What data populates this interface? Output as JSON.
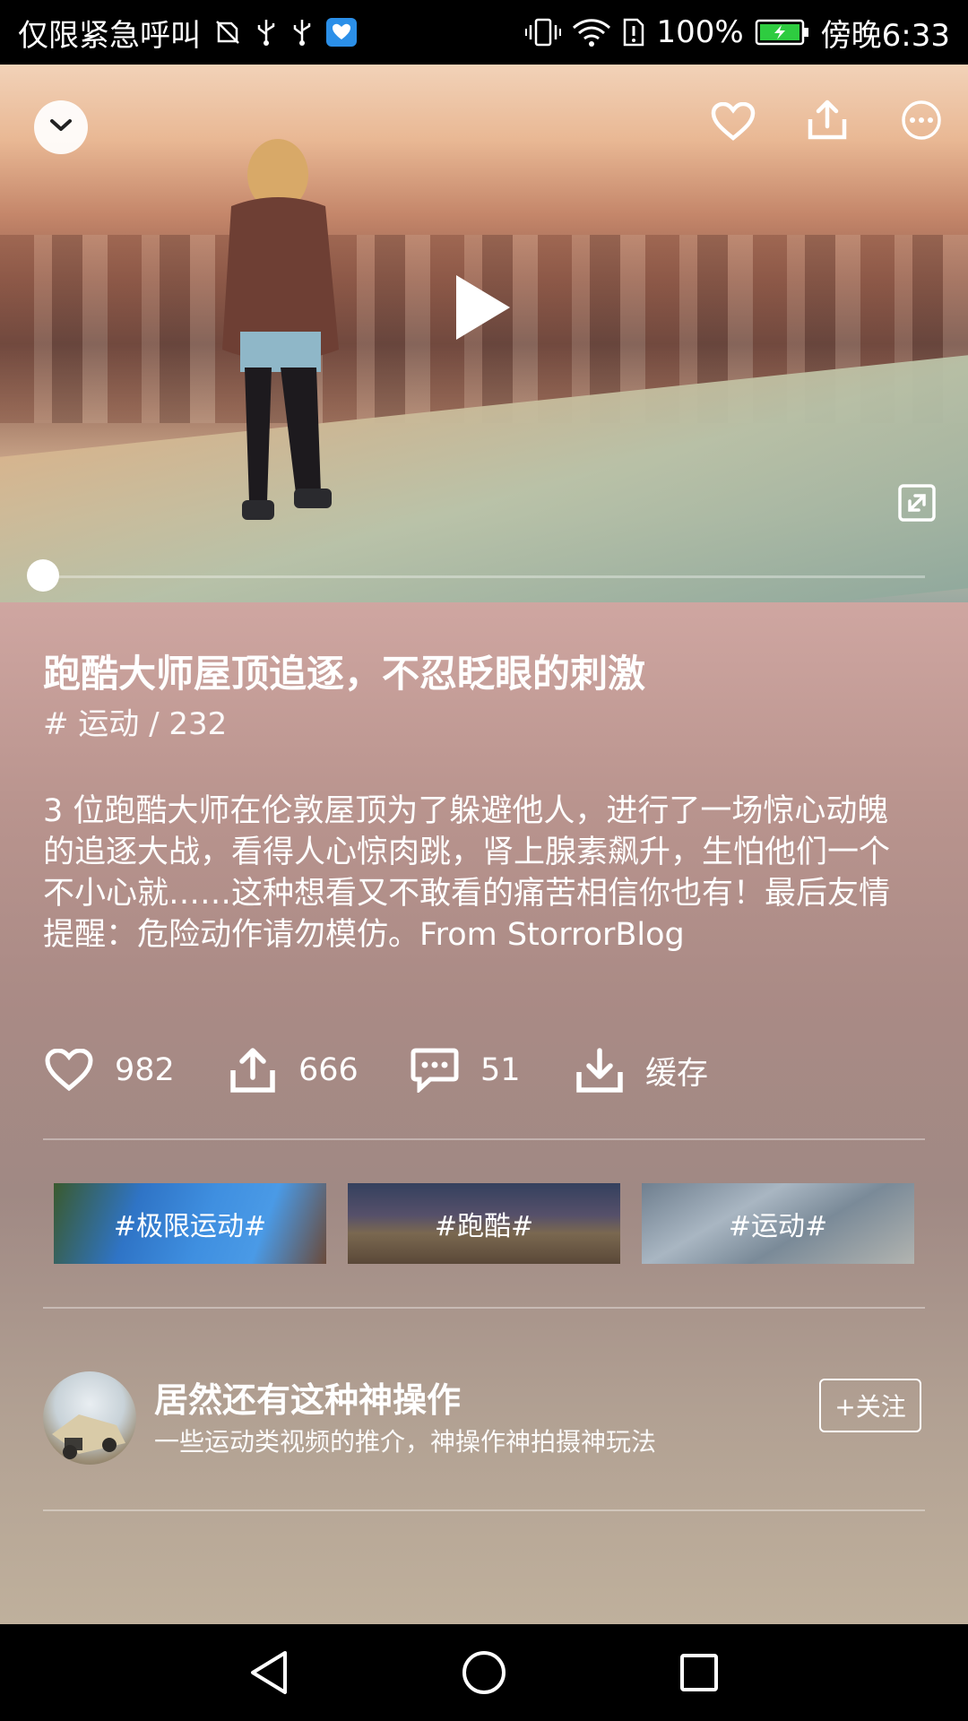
{
  "status_bar": {
    "carrier_text": "仅限紧急呼叫",
    "battery_text": "100%",
    "time_text": "傍晚6:33",
    "icons": [
      "no-sim-icon",
      "usb-icon",
      "usb-icon",
      "app-notification-icon",
      "vibrate-icon",
      "wifi-icon",
      "sim-alert-icon",
      "battery-charging-icon"
    ]
  },
  "video": {
    "controls": [
      "collapse-icon",
      "heart-icon",
      "share-icon",
      "more-icon",
      "play-icon",
      "fullscreen-icon"
    ],
    "progress": 0
  },
  "detail": {
    "title": "跑酷大师屋顶追逐，不忍眨眼的刺激",
    "subtitle": "# 运动 / 232",
    "description": "3 位跑酷大师在伦敦屋顶为了躲避他人，进行了一场惊心动魄的追逐大战，看得人心惊肉跳，肾上腺素飙升，生怕他们一个不小心就……这种想看又不敢看的痛苦相信你也有！最后友情提醒：危险动作请勿模仿。From StorrorBlog"
  },
  "stats": {
    "likes": "982",
    "shares": "666",
    "comments": "51",
    "cache_label": "缓存"
  },
  "tags": [
    {
      "label": "#极限运动#"
    },
    {
      "label": "#跑酷#"
    },
    {
      "label": "#运动#"
    }
  ],
  "author": {
    "name": "居然还有这种神操作",
    "description": "一些运动类视频的推介，神操作神拍摄神玩法",
    "follow_label": "+关注"
  },
  "nav_bar": {
    "icons": [
      "back-icon",
      "home-icon",
      "recent-apps-icon"
    ]
  },
  "colors": {
    "status_bar_bg": "#000000",
    "text_primary": "#ffffff",
    "battery_green": "#2ecc40"
  }
}
